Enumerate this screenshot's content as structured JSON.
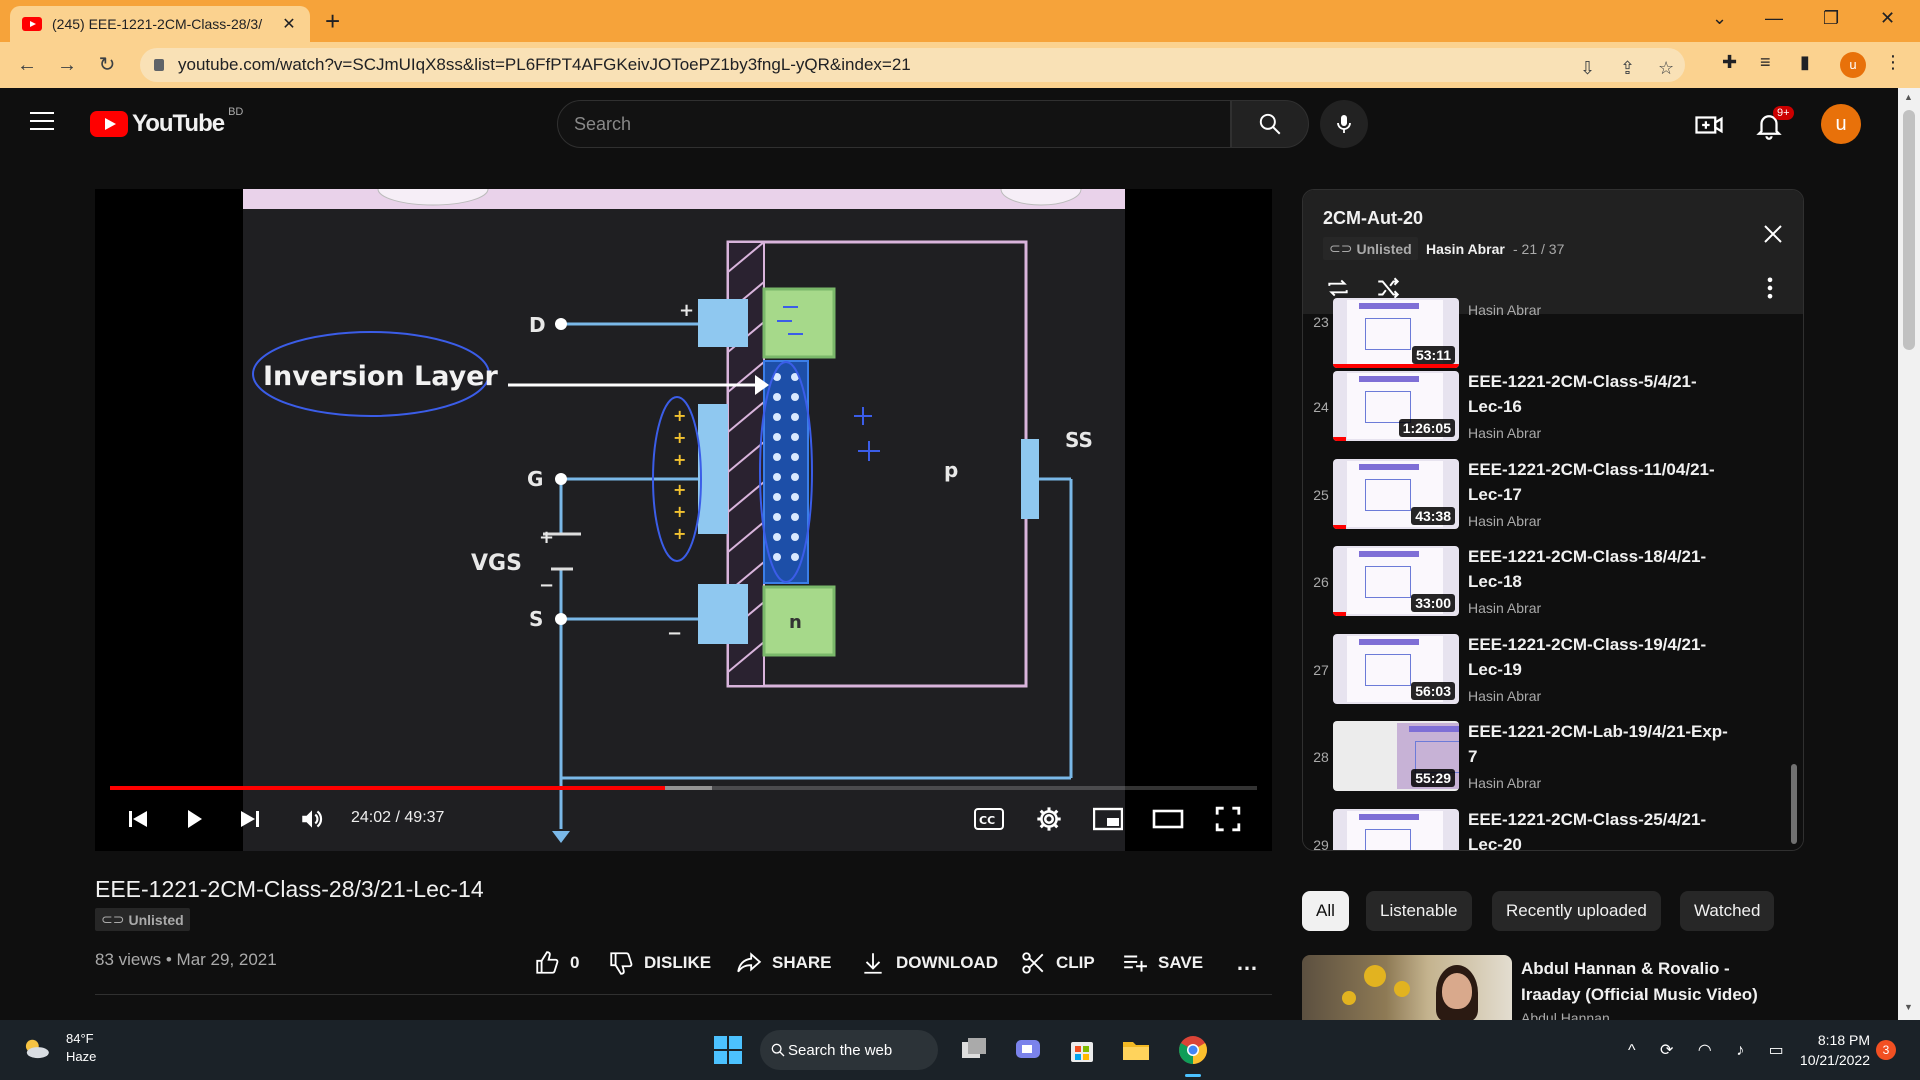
{
  "browser": {
    "tab_title": "(245) EEE-1221-2CM-Class-28/3/",
    "url": "youtube.com/watch?v=SCJmUIqX8ss&list=PL6FfPT4AFGKeivJOToePZ1by3fngL-yQR&index=21",
    "profile_initial": "u"
  },
  "header": {
    "logo_text": "YouTube",
    "country_code": "BD",
    "search_placeholder": "Search",
    "notifications_badge": "9+",
    "avatar_initial": "u"
  },
  "video_slide": {
    "label_drain": "D",
    "label_gate": "G",
    "label_source": "S",
    "label_vgs": "VGS",
    "label_substrate": "SS",
    "label_p": "p",
    "label_n": "n",
    "annotation": "Inversion Layer"
  },
  "player": {
    "time_current": "24:02",
    "time_separator": " / ",
    "time_total": "49:37",
    "progress_played_fraction": 0.484,
    "buffered_end_fraction": 0.525
  },
  "video": {
    "title": "EEE-1221-2CM-Class-28/3/21-Lec-14",
    "unlisted_label": "Unlisted",
    "views": "83 views",
    "date": "Mar 29, 2021",
    "meta_separator": " • ",
    "like_count": "0",
    "dislike_label": "DISLIKE",
    "share_label": "SHARE",
    "download_label": "DOWNLOAD",
    "clip_label": "CLIP",
    "save_label": "SAVE",
    "more_label": "…"
  },
  "playlist": {
    "title": "2CM-Aut-20",
    "unlisted_label": "Unlisted",
    "owner": "Hasin Abrar",
    "position": "- 21 / 37",
    "items": [
      {
        "index": "23",
        "title": "",
        "channel": "Hasin Abrar",
        "duration": "53:11",
        "watched_fraction": 1.0
      },
      {
        "index": "24",
        "title": "EEE-1221-2CM-Class-5/4/21-Lec-16",
        "channel": "Hasin Abrar",
        "duration": "1:26:05",
        "watched_fraction": 0.1
      },
      {
        "index": "25",
        "title": "EEE-1221-2CM-Class-11/04/21-Lec-17",
        "channel": "Hasin Abrar",
        "duration": "43:38",
        "watched_fraction": 0.1
      },
      {
        "index": "26",
        "title": "EEE-1221-2CM-Class-18/4/21-Lec-18",
        "channel": "Hasin Abrar",
        "duration": "33:00",
        "watched_fraction": 0.1
      },
      {
        "index": "27",
        "title": "EEE-1221-2CM-Class-19/4/21-Lec-19",
        "channel": "Hasin Abrar",
        "duration": "56:03",
        "watched_fraction": 0.0
      },
      {
        "index": "28",
        "title": "EEE-1221-2CM-Lab-19/4/21-Exp-7",
        "channel": "Hasin Abrar",
        "duration": "55:29",
        "watched_fraction": 0.0
      },
      {
        "index": "29",
        "title": "EEE-1221-2CM-Class-25/4/21-Lec-20",
        "channel": "",
        "duration": "",
        "watched_fraction": 0.0
      }
    ]
  },
  "chips": [
    "All",
    "Listenable",
    "Recently uploaded",
    "Watched"
  ],
  "recommendation": {
    "title": "Abdul Hannan & Rovalio - Iraaday (Official Music Video)",
    "channel": "Abdul Hannan"
  },
  "taskbar": {
    "temperature": "84°F",
    "weather": "Haze",
    "search_label": "Search the web",
    "time": "8:18 PM",
    "date": "10/21/2022",
    "notification_count": "3"
  },
  "colors": {
    "chrome_tabstrip": "#f6a33a",
    "chrome_toolbar": "#fbd28f",
    "yt_red": "#ff0000",
    "yt_bg": "#0f0f0f",
    "avatar": "#e8710a"
  }
}
